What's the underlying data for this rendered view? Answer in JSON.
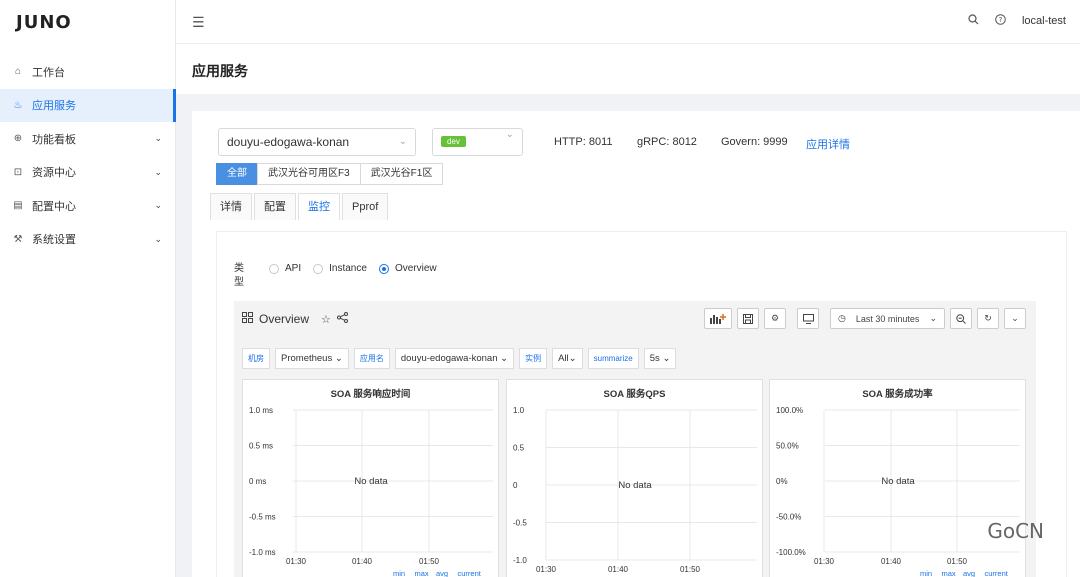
{
  "logo": "JUNO",
  "sidebar": {
    "items": [
      {
        "label": "工作台",
        "icon": "home-icon",
        "active": false,
        "expandable": false
      },
      {
        "label": "应用服务",
        "icon": "rocket-icon",
        "active": true,
        "expandable": false
      },
      {
        "label": "功能看板",
        "icon": "globe-icon",
        "active": false,
        "expandable": true
      },
      {
        "label": "资源中心",
        "icon": "scan-icon",
        "active": false,
        "expandable": true
      },
      {
        "label": "配置中心",
        "icon": "file-icon",
        "active": false,
        "expandable": true
      },
      {
        "label": "系统设置",
        "icon": "wrench-icon",
        "active": false,
        "expandable": true
      }
    ]
  },
  "header": {
    "user": "local-test"
  },
  "page": {
    "title": "应用服务"
  },
  "app": {
    "name": "douyu-edogawa-konan",
    "env": "dev",
    "http": "HTTP: 8011",
    "grpc": "gRPC: 8012",
    "govern": "Govern: 9999",
    "detail_link": "应用详情"
  },
  "zones": [
    "全部",
    "武汉光谷可用区F3",
    "武汉光谷F1区"
  ],
  "tabs": [
    "详情",
    "配置",
    "监控",
    "Pprof"
  ],
  "monitor": {
    "type_label": "类型",
    "type_label_1": "类",
    "type_label_2": "型",
    "options": [
      "API",
      "Instance",
      "Overview"
    ],
    "selected": "Overview"
  },
  "grafana": {
    "dashboard_title": "Overview",
    "time_range": "Last 30 minutes",
    "vars": [
      {
        "label": "机房",
        "value": "Prometheus"
      },
      {
        "label": "应用名",
        "value": "douyu-edogawa-konan"
      },
      {
        "label": "实例",
        "value": "All"
      },
      {
        "label": "summarize",
        "value": "5s"
      }
    ]
  },
  "panels": [
    {
      "title": "SOA 服务响应时间",
      "empty_text": "No data",
      "yticks": [
        "1.0 ms",
        "0.5 ms",
        "0 ms",
        "-0.5 ms",
        "-1.0 ms"
      ],
      "xticks": [
        "01:30",
        "01:40",
        "01:50"
      ],
      "legend": [
        "min",
        "max",
        "avg",
        "current"
      ]
    },
    {
      "title": "SOA 服务QPS",
      "empty_text": "No data",
      "yticks": [
        "1.0",
        "0.5",
        "0",
        "-0.5",
        "-1.0"
      ],
      "xticks": [
        "01:30",
        "01:40",
        "01:50"
      ],
      "legend": []
    },
    {
      "title": "SOA 服务成功率",
      "empty_text": "No data",
      "yticks": [
        "100.0%",
        "50.0%",
        "0%",
        "-50.0%",
        "-100.0%"
      ],
      "xticks": [
        "01:30",
        "01:40",
        "01:50"
      ],
      "legend": [
        "min",
        "max",
        "avg",
        "current"
      ]
    }
  ],
  "watermark": "GoCN"
}
